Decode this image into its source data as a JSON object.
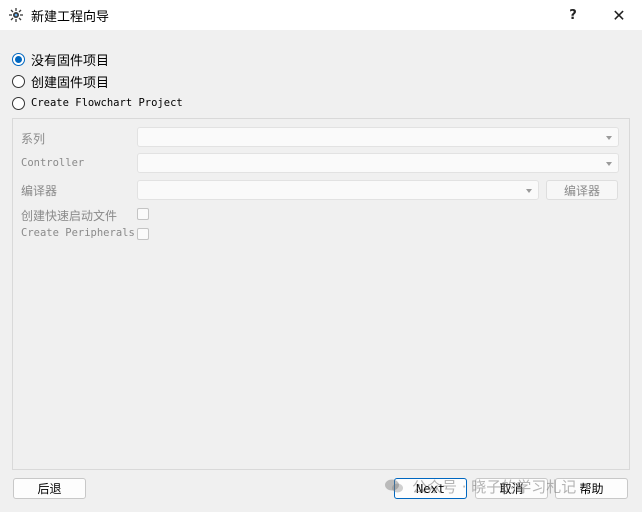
{
  "window": {
    "title": "新建工程向导",
    "help_glyph": "?",
    "close_glyph": "✕"
  },
  "options": [
    {
      "label": "没有固件项目",
      "checked": true
    },
    {
      "label": "创建固件项目",
      "checked": false
    },
    {
      "label": "Create Flowchart Project",
      "checked": false
    }
  ],
  "form": {
    "series_label": "系列",
    "series_value": "",
    "controller_label": "Controller",
    "controller_value": "",
    "compiler_label": "编译器",
    "compiler_value": "",
    "compiler_button": "编译器",
    "quickstart_label": "创建快速启动文件",
    "peripherals_label": "Create Peripherals"
  },
  "buttons": {
    "back": "后退",
    "next": "Next",
    "cancel": "取消",
    "help": "帮助"
  },
  "watermark": {
    "text": "公众号 · 晓子的学习札记"
  },
  "colors": {
    "accent": "#0067c0",
    "disabled_text": "#8a8a8a"
  }
}
